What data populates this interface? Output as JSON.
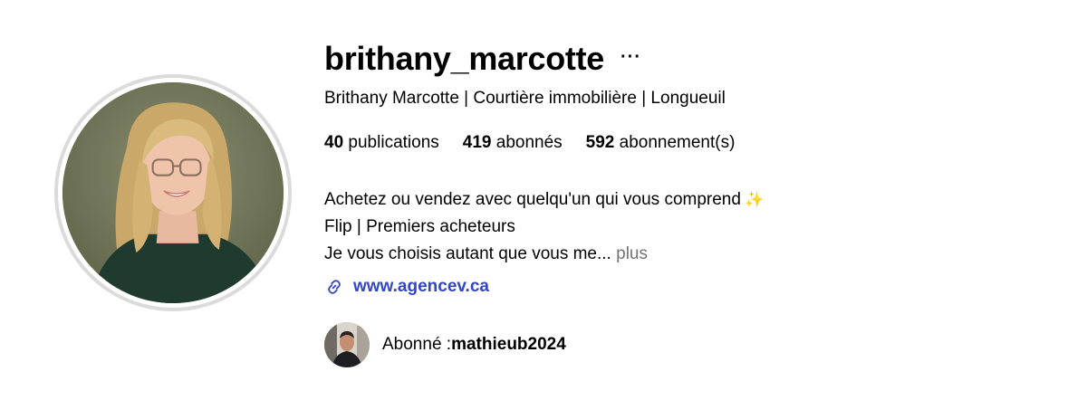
{
  "profile": {
    "username": "brithany_marcotte",
    "more_label": "···",
    "full_name": "Brithany Marcotte | Courtière immobilière | Longueuil",
    "stats": {
      "posts_count": "40",
      "posts_label": "publications",
      "followers_count": "419",
      "followers_label": "abonnés",
      "following_count": "592",
      "following_label": "abonnement(s)"
    },
    "bio": {
      "line1": "Achetez ou vendez avec quelqu'un qui vous comprend",
      "line1_emoji": "✨",
      "line2": "Flip | Premiers acheteurs",
      "line3": "Je vous choisis autant que vous me...",
      "more_label": "plus"
    },
    "website": "www.agencev.ca",
    "followed_by": {
      "prefix": "Abonné : ",
      "username": "mathieub2024"
    }
  },
  "colors": {
    "link": "#3346c4",
    "muted": "#737373",
    "ring": "#dbdbdb"
  },
  "icons": {
    "link": "link-icon",
    "more": "more-options-icon"
  }
}
